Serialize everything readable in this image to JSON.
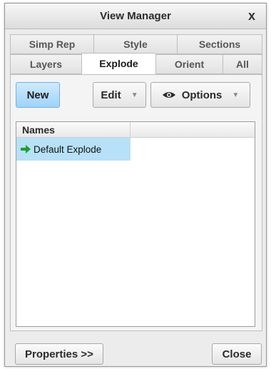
{
  "window": {
    "title": "View Manager",
    "close_glyph": "x"
  },
  "tabs": {
    "back_row": [
      {
        "label": "Simp Rep"
      },
      {
        "label": "Style"
      },
      {
        "label": "Sections"
      }
    ],
    "front_row": [
      {
        "label": "Layers"
      },
      {
        "label": "Explode",
        "active": true
      },
      {
        "label": "Orient"
      },
      {
        "label": "All"
      }
    ]
  },
  "toolbar": {
    "new_label": "New",
    "edit_label": "Edit",
    "options_label": "Options",
    "options_icon": "eye-icon",
    "dropdown_icon": "chevron-down-icon"
  },
  "list": {
    "columns": [
      "Names",
      ""
    ],
    "rows": [
      {
        "label": "Default Explode",
        "icon": "green-arrow-right-icon",
        "selected": true
      }
    ]
  },
  "footer": {
    "properties_label": "Properties >>",
    "close_label": "Close"
  },
  "colors": {
    "accent_button": "#a9d8fa",
    "selected_row": "#b7e1f8",
    "active_arrow": "#1f9e2e"
  }
}
